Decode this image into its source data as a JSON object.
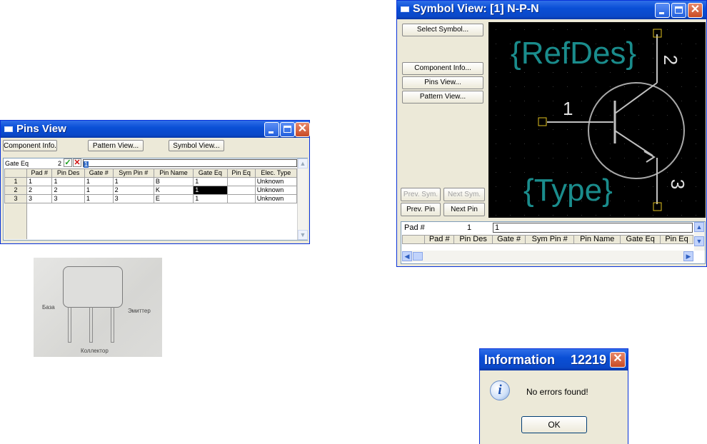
{
  "pins_view": {
    "title": "Pins View",
    "buttons": {
      "component_info": "Component Info...",
      "pattern_view": "Pattern View...",
      "symbol_view": "Symbol View..."
    },
    "gate_eq_label": "Gate Eq",
    "gate_eq_value": "2",
    "edit_value": "1",
    "columns": [
      "",
      "Pad #",
      "Pin Des",
      "Gate #",
      "Sym Pin #",
      "Pin Name",
      "Gate Eq",
      "Pin Eq",
      "Elec. Type"
    ],
    "rows": [
      [
        "1",
        "1",
        "1",
        "1",
        "1",
        "B",
        "1",
        "",
        "Unknown"
      ],
      [
        "2",
        "2",
        "2",
        "1",
        "2",
        "K",
        "1",
        "",
        "Unknown"
      ],
      [
        "3",
        "3",
        "3",
        "1",
        "3",
        "E",
        "1",
        "",
        "Unknown"
      ]
    ]
  },
  "photo": {
    "labels": {
      "base": "База",
      "emitter": "Эмиттер",
      "collector": "Коллектор"
    }
  },
  "symbol_view": {
    "title": "Symbol View: [1] N-P-N",
    "buttons": {
      "select_symbol": "Select Symbol...",
      "component_info": "Component Info...",
      "pins_view": "Pins View...",
      "pattern_view": "Pattern View...",
      "prev_sym": "Prev. Sym.",
      "next_sym": "Next Sym.",
      "prev_pin": "Prev. Pin",
      "next_pin": "Next Pin"
    },
    "canvas": {
      "refdes": "{RefDes}",
      "type": "{Type}",
      "pin1": "1",
      "pin2": "2",
      "pin3": "3"
    },
    "pad_label": "Pad #",
    "pad_value": "1",
    "edit_value": "1",
    "columns": [
      "Pad #",
      "Pin Des",
      "Gate #",
      "Sym Pin #",
      "Pin Name",
      "Gate Eq",
      "Pin Eq"
    ]
  },
  "info_dialog": {
    "title": "Information",
    "number": "12219",
    "message": "No errors found!",
    "ok": "OK"
  },
  "colors": {
    "title_blue": "#0a4fd6",
    "canvas_teal": "#1a8c8c",
    "pad_yellow": "#e0c020",
    "grid_gray": "#c0c0c0"
  }
}
